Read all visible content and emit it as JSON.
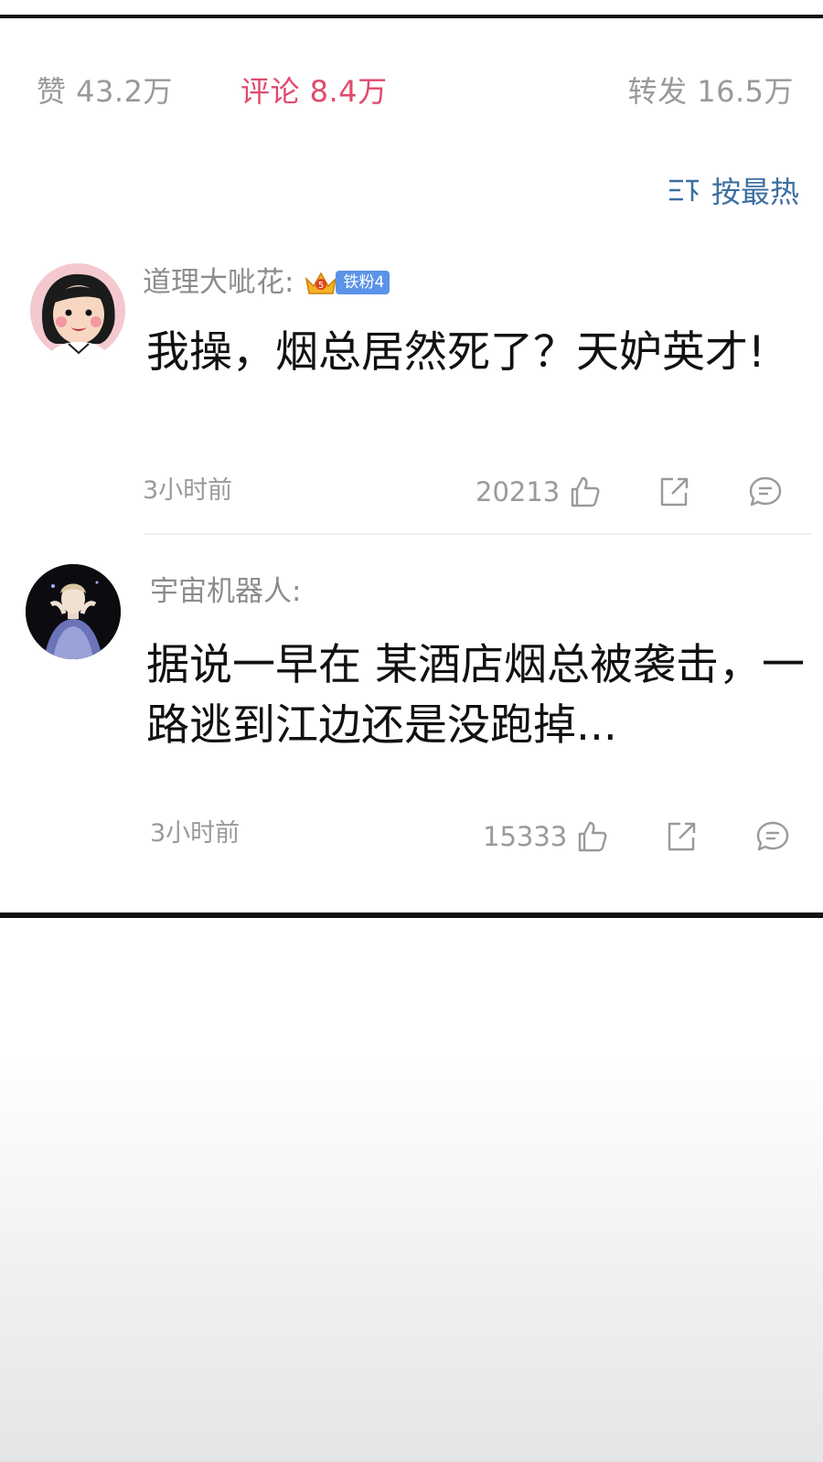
{
  "stats": {
    "likes": "赞 43.2万",
    "comments": "评论 8.4万",
    "reposts": "转发 16.5万"
  },
  "sort": {
    "label": "按最热",
    "icon": "sort-lines-icon"
  },
  "colors": {
    "active_tab": "#e04a6c",
    "sort_accent": "#3c6fa2",
    "muted_text": "#9a9a9a",
    "badge_blue": "#5b93e8"
  },
  "comments": [
    {
      "username": "道理大呲花:",
      "badge": {
        "level": "5",
        "label": "铁粉4"
      },
      "content": "我操，烟总居然死了？天妒英才!",
      "time": "3小时前",
      "likes": "20213"
    },
    {
      "username": "宇宙机器人:",
      "content": "据说一早在 某酒店烟总被袭击，一路逃到江边还是没跑掉...",
      "time": "3小时前",
      "likes": "15333"
    }
  ]
}
